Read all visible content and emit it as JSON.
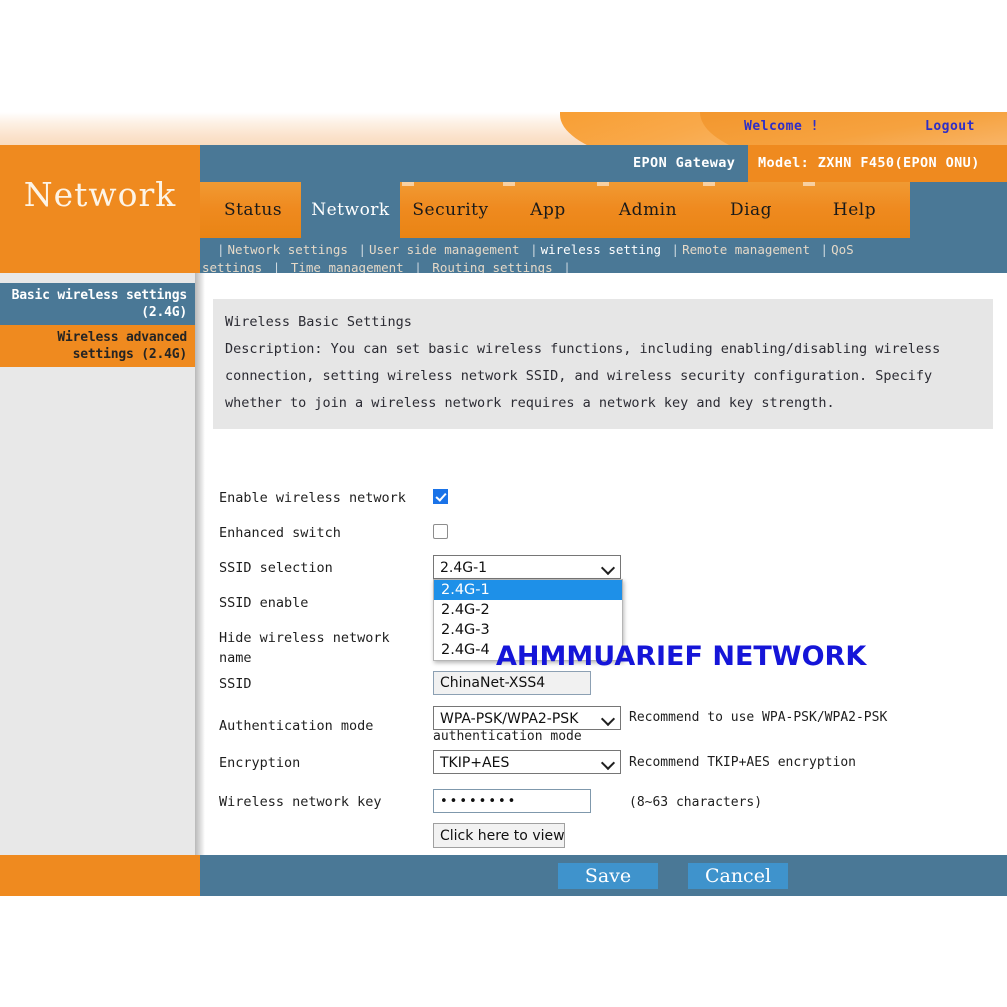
{
  "banner": {
    "welcome": "Welcome !",
    "logout": "Logout"
  },
  "modelbar": {
    "gateway": "EPON Gateway",
    "model": "Model: ZXHN F450(EPON ONU)"
  },
  "masthead": {
    "title": "Network"
  },
  "tabs": [
    {
      "label": "Status",
      "active": false
    },
    {
      "label": "Network",
      "active": true
    },
    {
      "label": "Security",
      "active": false
    },
    {
      "label": "App",
      "active": false
    },
    {
      "label": "Admin",
      "active": false
    },
    {
      "label": "Diag",
      "active": false
    },
    {
      "label": "Help",
      "active": false
    }
  ],
  "subnav": {
    "line1": [
      {
        "label": "Network settings",
        "active": false
      },
      {
        "label": "User side management",
        "active": false
      },
      {
        "label": "wireless setting",
        "active": true
      },
      {
        "label": "Remote management",
        "active": false
      },
      {
        "label": "QoS",
        "active": false
      }
    ],
    "line2": [
      {
        "label": "settings",
        "active": false
      },
      {
        "label": "Time management",
        "active": false
      },
      {
        "label": "Routing settings",
        "active": false
      }
    ]
  },
  "sidebar": {
    "items": [
      {
        "label": "Basic wireless settings (2.4G)",
        "active": true
      },
      {
        "label": "Wireless advanced settings (2.4G)",
        "active": false
      }
    ]
  },
  "content": {
    "heading": "Wireless Basic Settings",
    "description": "Description: You can set basic wireless functions, including enabling/disabling wireless connection, setting wireless network SSID, and wireless security configuration. Specify whether to join a wireless network requires a network key and key strength."
  },
  "form": {
    "enable_wireless_label": "Enable wireless network",
    "enable_wireless_checked": true,
    "enhanced_switch_label": "Enhanced switch",
    "enhanced_switch_checked": false,
    "ssid_selection_label": "SSID selection",
    "ssid_selection_value": "2.4G-1",
    "ssid_selection_options": [
      "2.4G-1",
      "2.4G-2",
      "2.4G-3",
      "2.4G-4"
    ],
    "ssid_enable_label": "SSID enable",
    "hide_ssid_label": "Hide wireless network name",
    "ssid_label": "SSID",
    "ssid_value": "ChinaNet-XSS4",
    "auth_mode_label": "Authentication mode",
    "auth_mode_value": "WPA-PSK/WPA2-PSK",
    "auth_hint_line1": "Recommend to use WPA-PSK/WPA2-PSK",
    "auth_hint_line2": "authentication mode",
    "encryption_label": "Encryption",
    "encryption_value": "TKIP+AES",
    "encryption_hint": "Recommend TKIP+AES encryption",
    "key_label": "Wireless network key",
    "key_value": "••••••••",
    "key_hint": "(8~63 characters)",
    "view_key_button": "Click here to view"
  },
  "watermark": {
    "text": "AHMMUARIEF NETWORK"
  },
  "footer": {
    "save": "Save",
    "cancel": "Cancel"
  },
  "colors": {
    "orange": "#ef8a1f",
    "blue_gray": "#4a7896",
    "button_blue": "#3f93cc",
    "highlight_blue": "#1e90e8",
    "watermark_blue": "#1515d8",
    "link_blue": "#2e2ec8"
  }
}
